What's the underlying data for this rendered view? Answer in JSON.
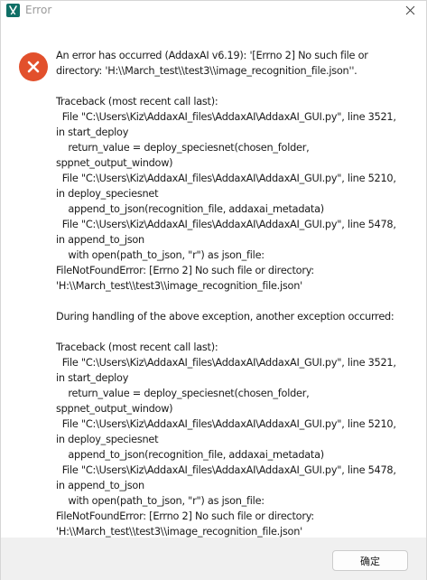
{
  "window": {
    "title": "Error",
    "app_icon": "addaxai-app-icon",
    "close_icon": "close-icon"
  },
  "dialog": {
    "icon": "error-x-circle-icon",
    "message_lines": [
      "An error has occurred (AddaxAI v6.19): '[Errno 2] No such file or",
      "directory: 'H:\\\\March_test\\\\test3\\\\image_recognition_file.json''.",
      "",
      "Traceback (most recent call last):",
      "  File \"C:\\Users\\Kiz\\AddaxAI_files\\AddaxAI\\AddaxAI_GUI.py\", line 3521,",
      "in start_deploy",
      "    return_value = deploy_speciesnet(chosen_folder,",
      "sppnet_output_window)",
      "  File \"C:\\Users\\Kiz\\AddaxAI_files\\AddaxAI\\AddaxAI_GUI.py\", line 5210,",
      "in deploy_speciesnet",
      "    append_to_json(recognition_file, addaxai_metadata)",
      "  File \"C:\\Users\\Kiz\\AddaxAI_files\\AddaxAI\\AddaxAI_GUI.py\", line 5478,",
      "in append_to_json",
      "    with open(path_to_json, \"r\") as json_file:",
      "FileNotFoundError: [Errno 2] No such file or directory:",
      "'H:\\\\March_test\\\\test3\\\\image_recognition_file.json'",
      "",
      "During handling of the above exception, another exception occurred:",
      "",
      "Traceback (most recent call last):",
      "  File \"C:\\Users\\Kiz\\AddaxAI_files\\AddaxAI\\AddaxAI_GUI.py\", line 3521,",
      "in start_deploy",
      "    return_value = deploy_speciesnet(chosen_folder,",
      "sppnet_output_window)",
      "  File \"C:\\Users\\Kiz\\AddaxAI_files\\AddaxAI\\AddaxAI_GUI.py\", line 5210,",
      "in deploy_speciesnet",
      "    append_to_json(recognition_file, addaxai_metadata)",
      "  File \"C:\\Users\\Kiz\\AddaxAI_files\\AddaxAI\\AddaxAI_GUI.py\", line 5478,",
      "in append_to_json",
      "    with open(path_to_json, \"r\") as json_file:",
      "FileNotFoundError: [Errno 2] No such file or directory:",
      "'H:\\\\March_test\\\\test3\\\\image_recognition_file.json'"
    ]
  },
  "footer": {
    "ok_label": "确定"
  },
  "colors": {
    "error_icon": "#e2502c",
    "app_icon": "#0f6f66",
    "footer_bg": "#f0f0f0",
    "title_text": "#9a9a9a"
  }
}
